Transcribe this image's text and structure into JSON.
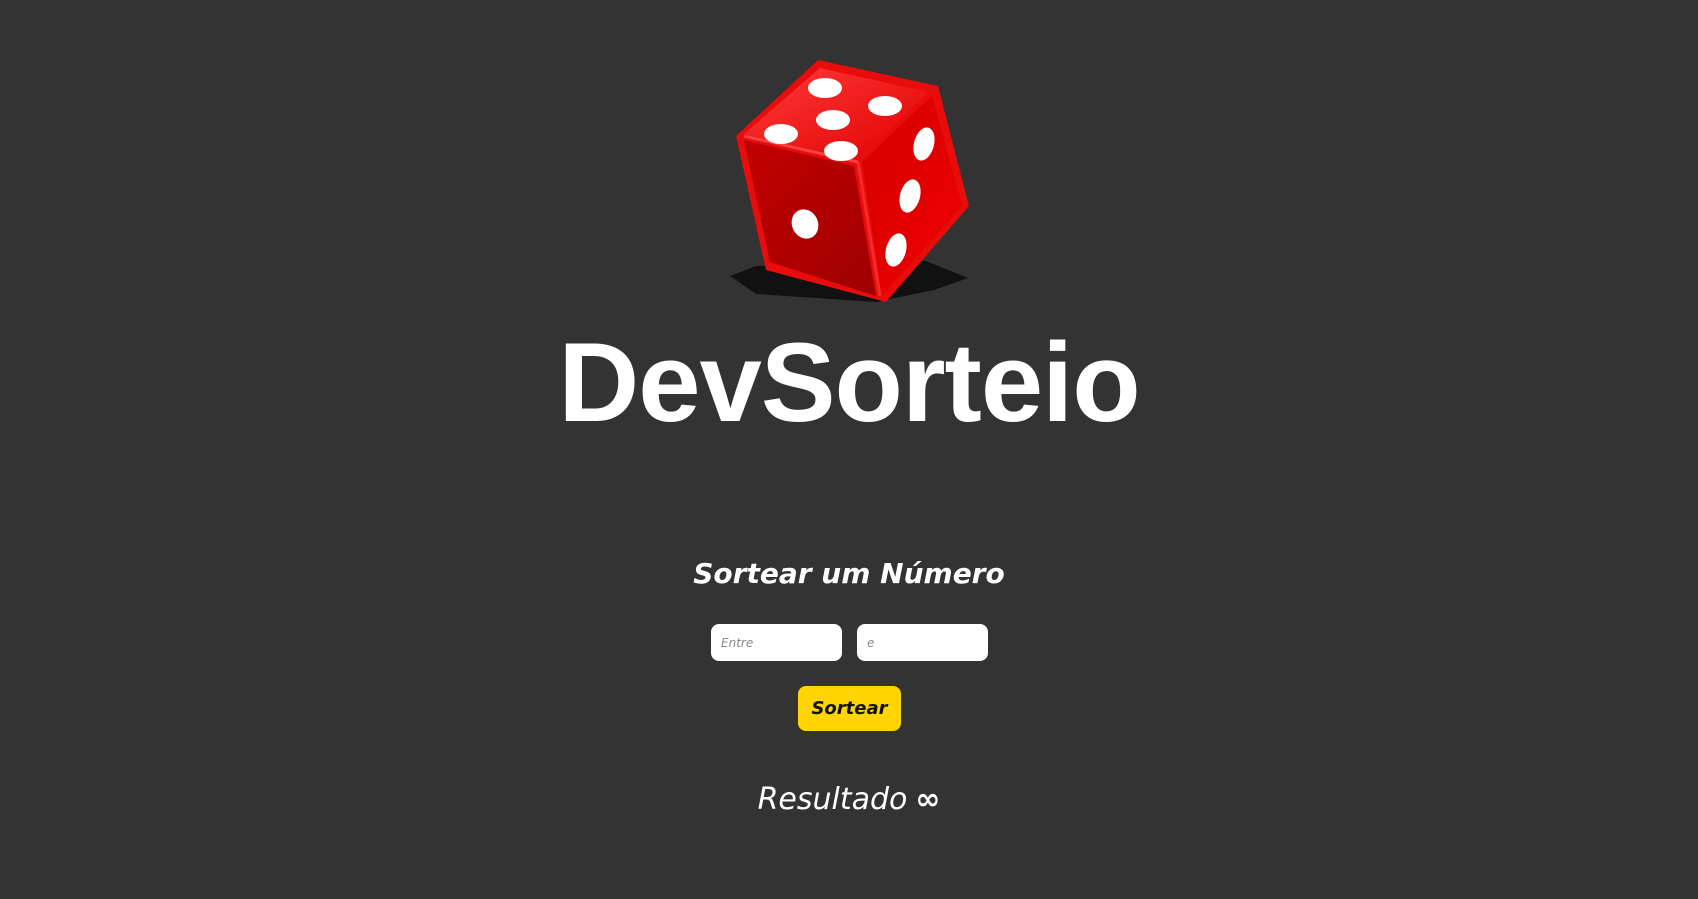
{
  "logo": {
    "icon": "dice-icon",
    "title": "DevSorteio",
    "colors": {
      "dice": "#e60000",
      "pips": "#ffffff"
    }
  },
  "draw": {
    "title": "Sortear um Número",
    "min_input": {
      "placeholder": "Entre",
      "value": ""
    },
    "max_input": {
      "placeholder": "e",
      "value": ""
    },
    "button_label": "Sortear",
    "button_color": "#ffd400"
  },
  "result": {
    "label": "Resultado",
    "value": "∞"
  },
  "theme": {
    "background": "#333333",
    "text": "#ffffff"
  }
}
